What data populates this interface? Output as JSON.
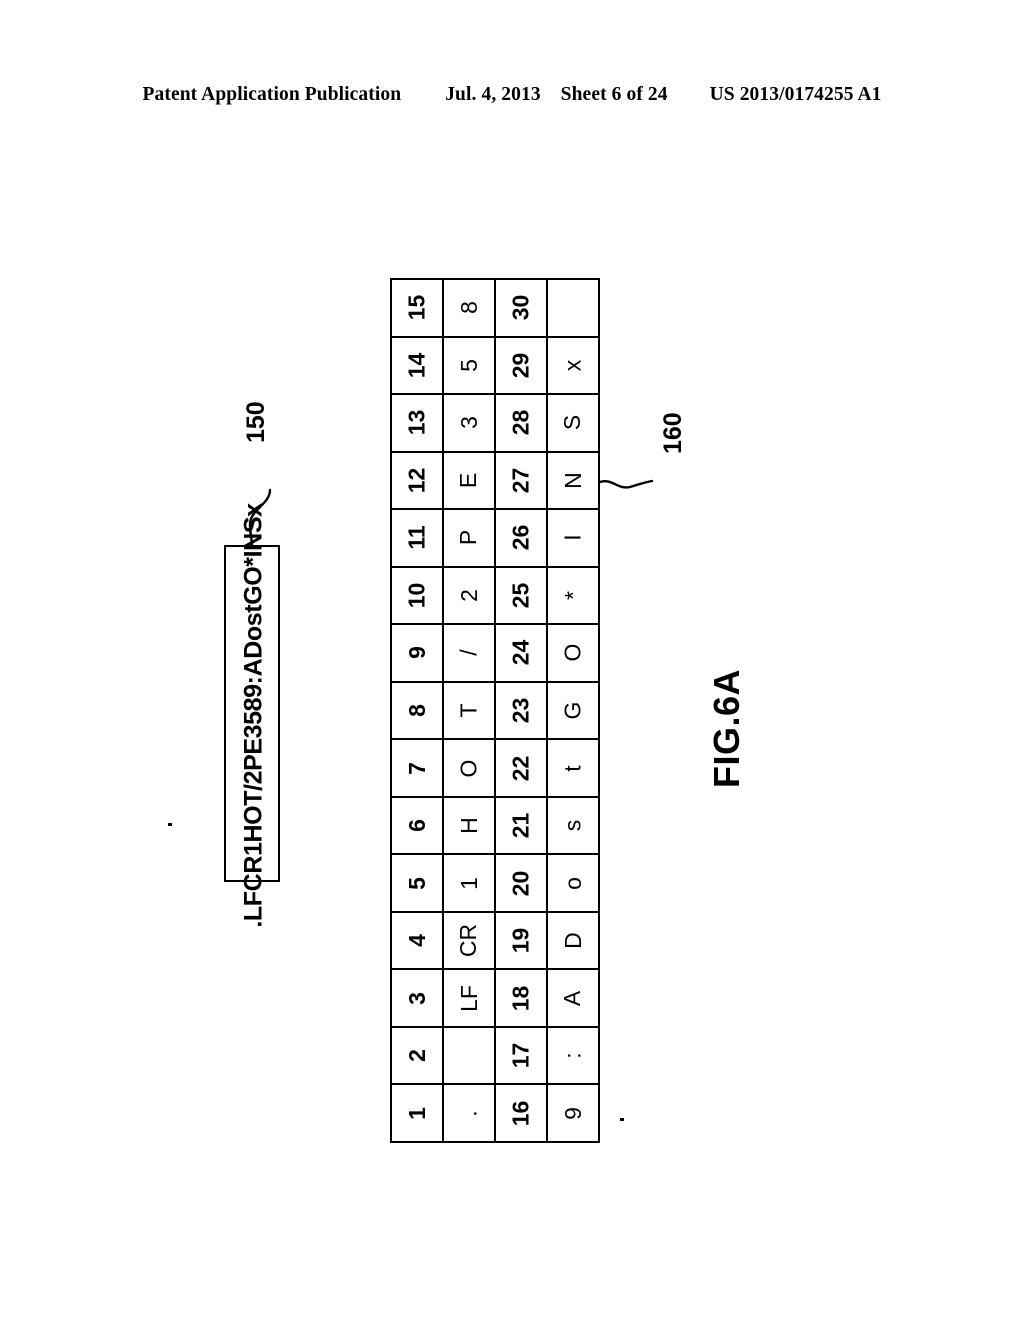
{
  "header": {
    "publication": "Patent Application Publication",
    "date": "Jul. 4, 2013",
    "sheet": "Sheet 6 of 24",
    "patent_number": "US 2013/0174255 A1"
  },
  "figure": {
    "caption": "FIG.6A",
    "string_box": {
      "ref": "150",
      "value": ".LFCR1HOT/2PE3589:ADostGO*INSx"
    },
    "table": {
      "ref": "160",
      "columns": [
        {
          "index_low": "1",
          "char_low": ".",
          "index_high": "16",
          "char_high": "9"
        },
        {
          "index_low": "2",
          "char_low": "",
          "index_high": "17",
          "char_high": ":"
        },
        {
          "index_low": "3",
          "char_low": "LF",
          "index_high": "18",
          "char_high": "A"
        },
        {
          "index_low": "4",
          "char_low": "CR",
          "index_high": "19",
          "char_high": "D"
        },
        {
          "index_low": "5",
          "char_low": "1",
          "index_high": "20",
          "char_high": "o"
        },
        {
          "index_low": "6",
          "char_low": "H",
          "index_high": "21",
          "char_high": "s"
        },
        {
          "index_low": "7",
          "char_low": "O",
          "index_high": "22",
          "char_high": "t"
        },
        {
          "index_low": "8",
          "char_low": "T",
          "index_high": "23",
          "char_high": "G"
        },
        {
          "index_low": "9",
          "char_low": "/",
          "index_high": "24",
          "char_high": "O"
        },
        {
          "index_low": "10",
          "char_low": "2",
          "index_high": "25",
          "char_high": "*"
        },
        {
          "index_low": "11",
          "char_low": "P",
          "index_high": "26",
          "char_high": "I"
        },
        {
          "index_low": "12",
          "char_low": "E",
          "index_high": "27",
          "char_high": "N"
        },
        {
          "index_low": "13",
          "char_low": "3",
          "index_high": "28",
          "char_high": "S"
        },
        {
          "index_low": "14",
          "char_low": "5",
          "index_high": "29",
          "char_high": "x"
        },
        {
          "index_low": "15",
          "char_low": "8",
          "index_high": "30",
          "char_high": ""
        }
      ]
    }
  },
  "colors": {
    "ink": "#000000",
    "paper": "#ffffff"
  }
}
